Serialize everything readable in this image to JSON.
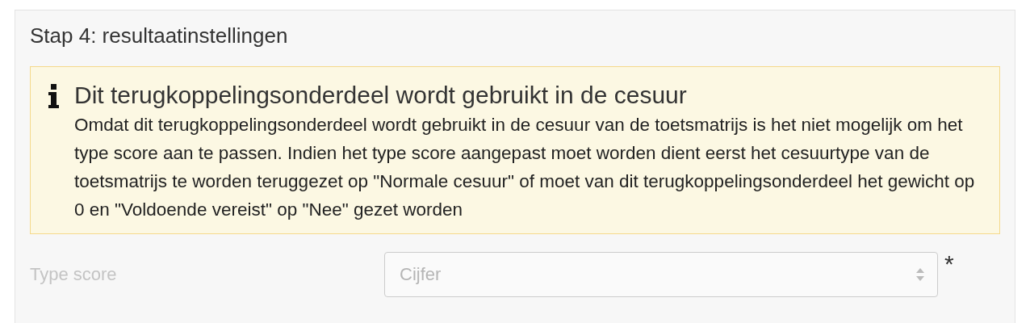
{
  "section": {
    "title": "Stap 4: resultaatinstellingen"
  },
  "alert": {
    "kind": "info",
    "title": "Dit terugkoppelingsonderdeel wordt gebruikt in de cesuur",
    "body": "Omdat dit terugkoppelingsonderdeel wordt gebruikt in de cesuur van de toetsmatrijs is het niet mogelijk om het type score aan te passen. Indien het type score aangepast moet worden dient eerst het cesuurtype van de toetsmatrijs te worden teruggezet op \"Normale cesuur\" of moet van dit terugkoppelingsonderdeel het gewicht op 0 en \"Voldoende vereist\" op \"Nee\" gezet worden"
  },
  "fields": [
    {
      "label": "Type score",
      "value": "Cijfer",
      "disabled": true,
      "required_mark": "*"
    }
  ]
}
